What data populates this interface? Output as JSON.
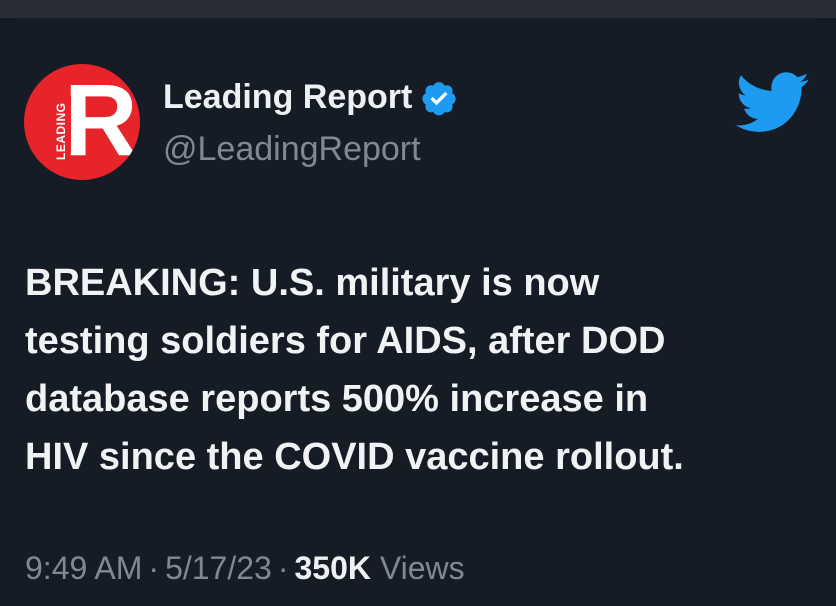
{
  "account": {
    "display_name": "Leading Report",
    "handle": "@LeadingReport",
    "avatar_letter": "R",
    "avatar_vertical_text": "LEADING",
    "verified": true
  },
  "tweet": {
    "lines": [
      "BREAKING: U.S. military is now",
      "testing soldiers for AIDS, after DOD",
      "database reports 500% increase in",
      "HIV since the COVID vaccine rollout."
    ],
    "time": "9:49 AM",
    "date": "5/17/23",
    "separator": "·",
    "views_count": "350K",
    "views_label": "Views"
  },
  "colors": {
    "background": "#161c26",
    "accent_blue": "#1d9bf0",
    "avatar_red": "#e6242a",
    "secondary_text": "#7f8994"
  },
  "icons": {
    "brand": "twitter-bird-icon",
    "verified": "verified-badge-icon"
  }
}
